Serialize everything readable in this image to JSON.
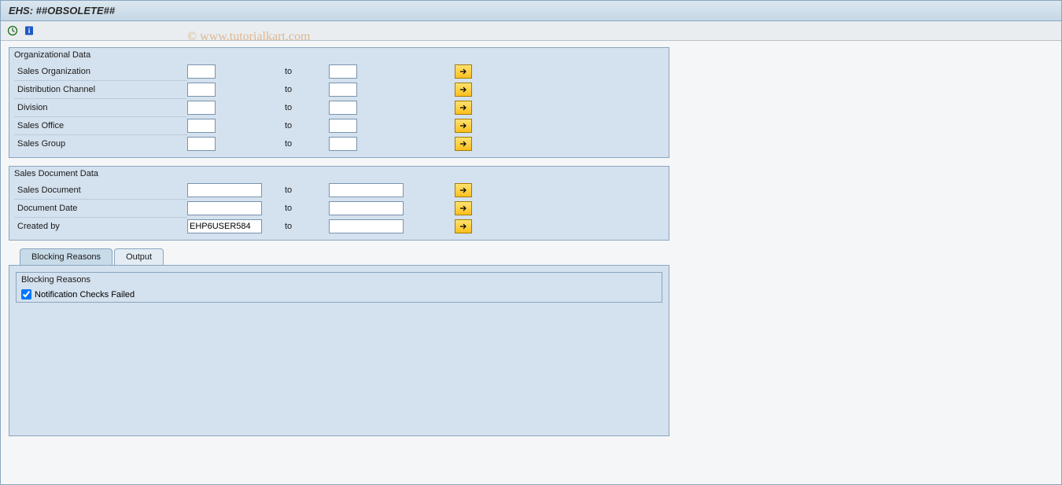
{
  "title": "EHS: ##OBSOLETE##",
  "watermark": "© www.tutorialkart.com",
  "toolbar": {
    "executeIcon": "execute-icon",
    "infoIcon": "info-icon"
  },
  "orgData": {
    "title": "Organizational Data",
    "to": "to",
    "rows": [
      {
        "label": "Sales Organization",
        "from": "",
        "to": ""
      },
      {
        "label": "Distribution Channel",
        "from": "",
        "to": ""
      },
      {
        "label": "Division",
        "from": "",
        "to": ""
      },
      {
        "label": "Sales Office",
        "from": "",
        "to": ""
      },
      {
        "label": "Sales Group",
        "from": "",
        "to": ""
      }
    ]
  },
  "salesDoc": {
    "title": "Sales Document Data",
    "to": "to",
    "rows": [
      {
        "label": "Sales Document",
        "from": "",
        "to": ""
      },
      {
        "label": "Document Date",
        "from": "",
        "to": ""
      },
      {
        "label": "Created by",
        "from": "EHP6USER584",
        "to": ""
      }
    ]
  },
  "tabs": {
    "blocking": "Blocking Reasons",
    "output": "Output"
  },
  "blockReasons": {
    "title": "Blocking Reasons",
    "checkLabel": "Notification Checks Failed",
    "checked": true
  }
}
